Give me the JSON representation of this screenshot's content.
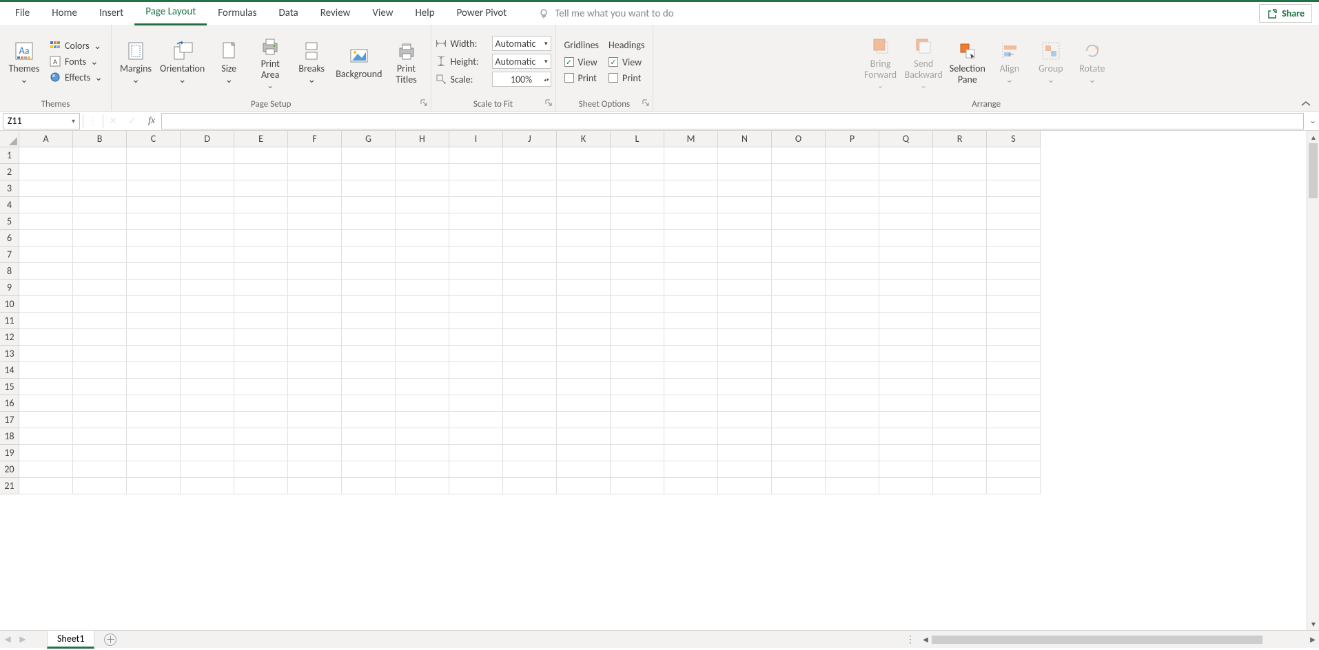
{
  "tabs": [
    "File",
    "Home",
    "Insert",
    "Page Layout",
    "Formulas",
    "Data",
    "Review",
    "View",
    "Help",
    "Power Pivot"
  ],
  "active_tab": "Page Layout",
  "tell_me": "Tell me what you want to do",
  "share": "Share",
  "ribbon": {
    "themes": {
      "label": "Themes",
      "themes_btn": "Themes",
      "colors": "Colors",
      "fonts": "Fonts",
      "effects": "Effects"
    },
    "page_setup": {
      "label": "Page Setup",
      "margins": "Margins",
      "orientation": "Orientation",
      "size": "Size",
      "print_area": "Print\nArea",
      "breaks": "Breaks",
      "background": "Background",
      "print_titles": "Print\nTitles"
    },
    "scale_to_fit": {
      "label": "Scale to Fit",
      "width_label": "Width:",
      "width_value": "Automatic",
      "height_label": "Height:",
      "height_value": "Automatic",
      "scale_label": "Scale:",
      "scale_value": "100%"
    },
    "sheet_options": {
      "label": "Sheet Options",
      "gridlines": "Gridlines",
      "headings": "Headings",
      "view": "View",
      "print": "Print"
    },
    "arrange": {
      "label": "Arrange",
      "bring_forward": "Bring\nForward",
      "send_backward": "Send\nBackward",
      "selection_pane": "Selection\nPane",
      "align": "Align",
      "group": "Group",
      "rotate": "Rotate"
    }
  },
  "name_box": "Z11",
  "columns": [
    "A",
    "B",
    "C",
    "D",
    "E",
    "F",
    "G",
    "H",
    "I",
    "J",
    "K",
    "L",
    "M",
    "N",
    "O",
    "P",
    "Q",
    "R",
    "S"
  ],
  "rows": [
    1,
    2,
    3,
    4,
    5,
    6,
    7,
    8,
    9,
    10,
    11,
    12,
    13,
    14,
    15,
    16,
    17,
    18,
    19,
    20,
    21
  ],
  "sheet_tab": "Sheet1"
}
